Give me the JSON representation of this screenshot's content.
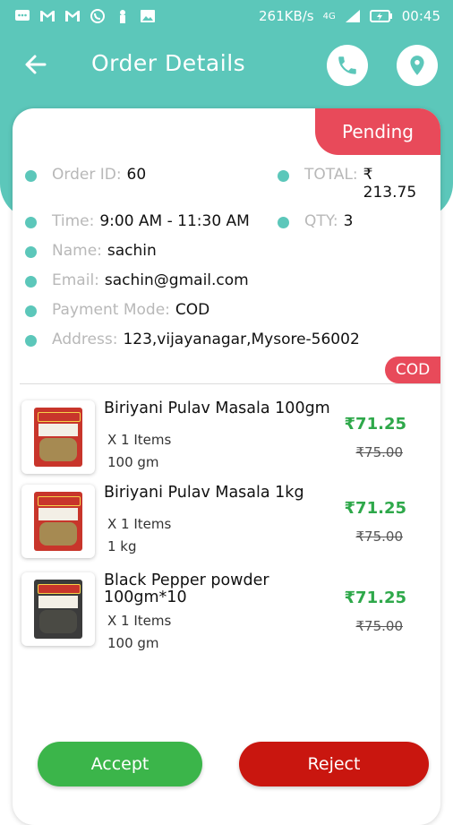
{
  "status_bar": {
    "network_speed": "261KB/s",
    "network_type": "4G",
    "time": "00:45",
    "icons": [
      "message-icon",
      "gmail-icon",
      "gmail-icon",
      "whatsapp-icon",
      "person-icon",
      "image-icon",
      "signal-icon",
      "battery-icon"
    ]
  },
  "header": {
    "title": "Order Details",
    "back_icon": "arrow-left-icon",
    "call_icon": "phone-icon",
    "location_icon": "location-pin-icon"
  },
  "order": {
    "status": "Pending",
    "id_label": "Order ID:",
    "id_value": "60",
    "total_label": "TOTAL:",
    "total_value_currency": "₹",
    "total_value_amount": "213.75",
    "time_label": "Time:",
    "time_value": "9:00 AM - 11:30 AM",
    "qty_label": "QTY:",
    "qty_value": "3",
    "name_label": "Name:",
    "name_value": "sachin",
    "email_label": "Email:",
    "email_value": "sachin@gmail.com",
    "payment_label": "Payment Mode:",
    "payment_value": "COD",
    "address_label": "Address:",
    "address_value": "123,vijayanagar,Mysore-56002",
    "badge": "COD"
  },
  "items": [
    {
      "name": "Biriyani Pulav Masala 100gm",
      "qty": "X 1 Items",
      "size": "100 gm",
      "price": "₹71.25",
      "mrp": "₹75.00"
    },
    {
      "name": "Biriyani Pulav Masala 1kg",
      "qty": "X 1 Items",
      "size": "1 kg",
      "price": "₹71.25",
      "mrp": "₹75.00"
    },
    {
      "name": "Black Pepper powder 100gm*10",
      "qty": "X 1 Items",
      "size": "100 gm",
      "price": "₹71.25",
      "mrp": "₹75.00"
    }
  ],
  "actions": {
    "accept": "Accept",
    "reject": "Reject"
  },
  "colors": {
    "teal": "#5cc7ba",
    "pending_red": "#e84a5a",
    "accept_green": "#3bb54a",
    "reject_red": "#c9160f",
    "price_green": "#2ea84a"
  }
}
